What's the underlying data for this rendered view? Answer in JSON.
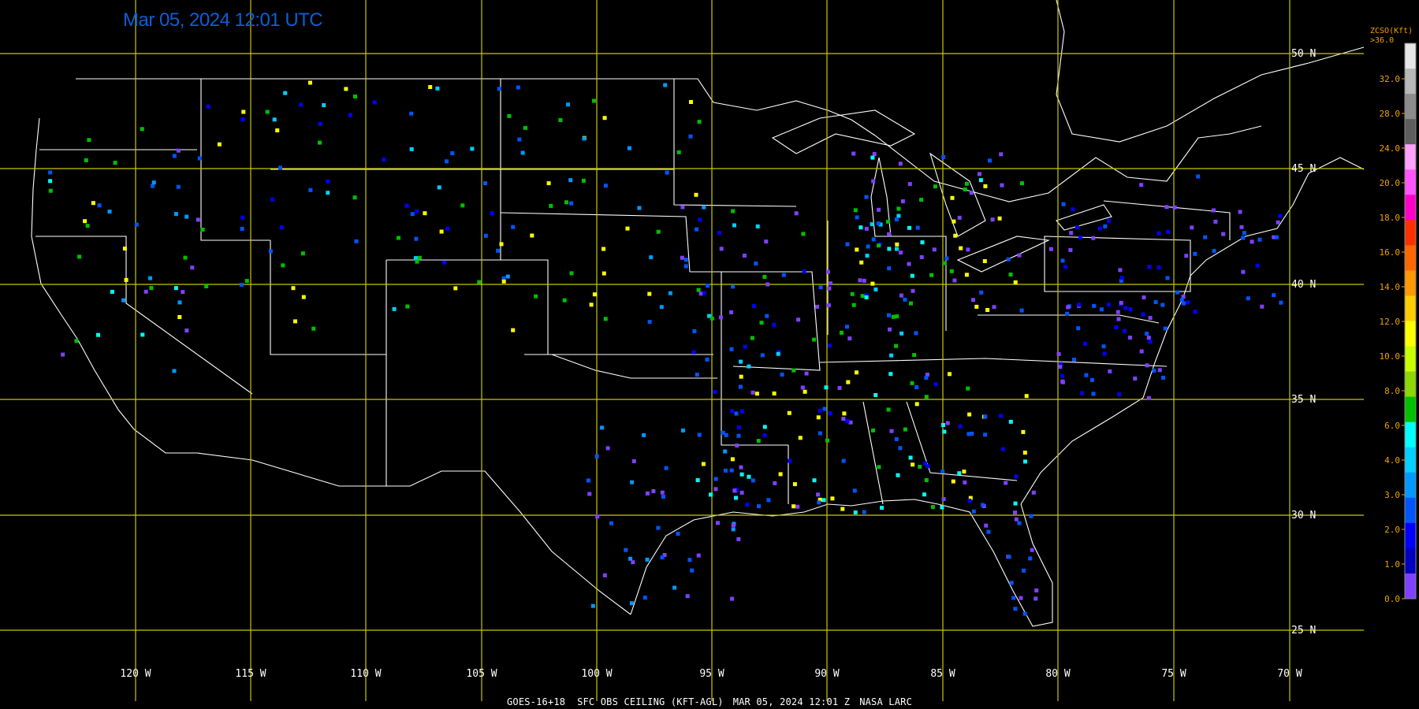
{
  "timestamp": "Mar 05, 2024 12:01 UTC",
  "footer": {
    "product": "GOES-16+18  SFC OBS CEILING (KFT-AGL)",
    "datetime": "MAR 05, 2024 12:01 Z",
    "credit": "NASA LARC"
  },
  "latitude_labels": [
    "50 N",
    "45 N",
    "40 N",
    "35 N",
    "30 N",
    "25 N"
  ],
  "longitude_labels": [
    "120 W",
    "115 W",
    "110 W",
    "105 W",
    "100 W",
    "95 W",
    "90 W",
    "85 W",
    "80 W",
    "75 W",
    "70 W"
  ],
  "legend": {
    "title": "ZCSO(Kft)",
    "top_label": ">36.0",
    "tick_labels": [
      "32.0",
      "28.0",
      "24.0",
      "20.0",
      "18.0",
      "16.0",
      "14.0",
      "12.0",
      "10.0",
      "8.0",
      "6.0",
      "4.0",
      "3.0",
      "2.0",
      "1.0",
      "0.0"
    ],
    "colors": [
      "#e6e6e6",
      "#b8b8b8",
      "#8c8c8c",
      "#5e5e5e",
      "#ffa0ff",
      "#ff55ff",
      "#ff00c8",
      "#ff3000",
      "#ff6600",
      "#ff9900",
      "#ffcc00",
      "#ffff00",
      "#c8ff00",
      "#8cd800",
      "#00c000",
      "#00ffff",
      "#00d0ff",
      "#0099ff",
      "#0055ff",
      "#0000ff",
      "#0000c0",
      "#8040ff"
    ]
  },
  "colors": {
    "grid": "#c8c800",
    "boundaries": "#ffffff",
    "timestamp": "#0a5fd8",
    "labels": "#ffffff",
    "legend_text": "#f0a000"
  }
}
